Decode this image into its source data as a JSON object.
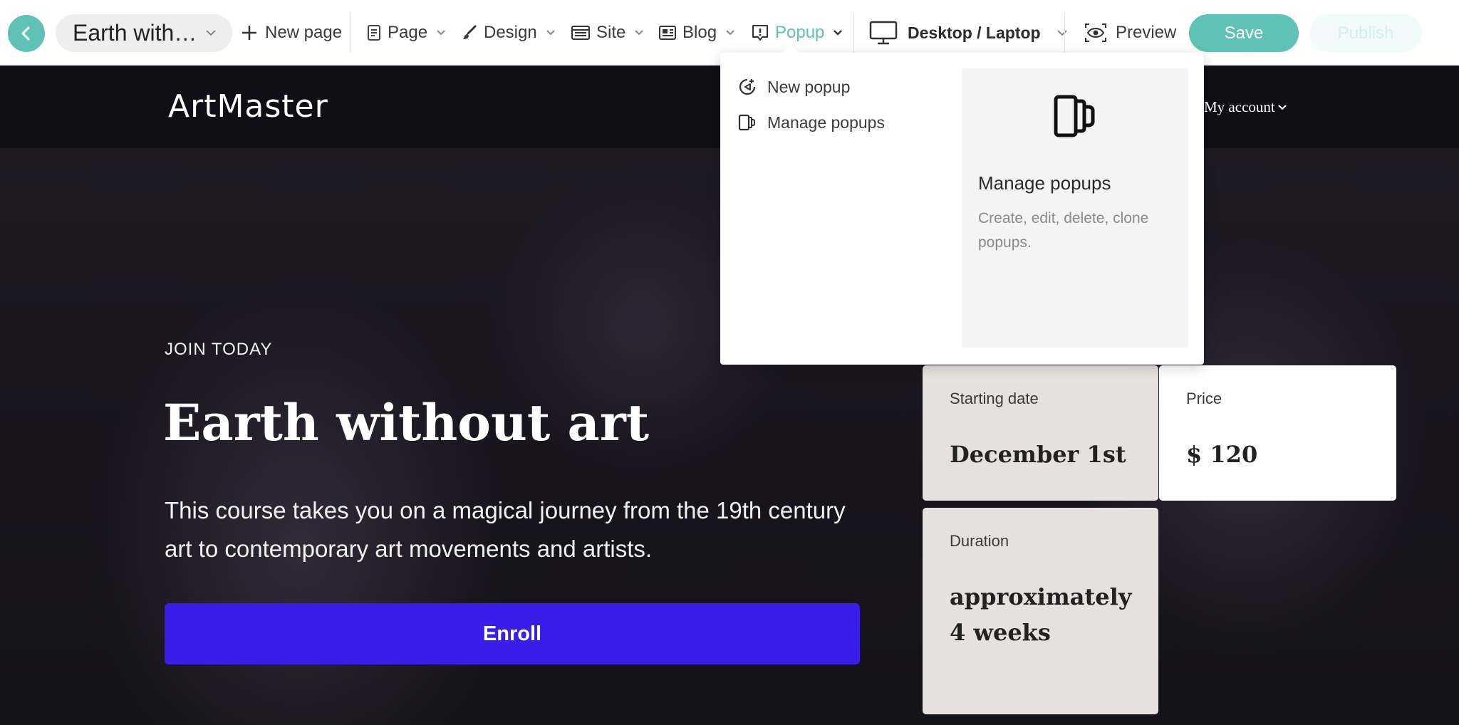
{
  "toolbar": {
    "page_title": "Earth with…",
    "new_page_label": "New page",
    "menus": [
      {
        "label": "Page"
      },
      {
        "label": "Design"
      },
      {
        "label": "Site"
      },
      {
        "label": "Blog"
      },
      {
        "label": "Popup"
      }
    ],
    "device_label": "Desktop / Laptop",
    "preview_label": "Preview",
    "save_label": "Save",
    "publish_label": "Publish",
    "accent_color": "#5fc2b5"
  },
  "popup_dropdown": {
    "items": [
      {
        "label": "New popup",
        "icon": "new-popup-icon"
      },
      {
        "label": "Manage popups",
        "icon": "manage-popups-icon"
      }
    ],
    "panel": {
      "title": "Manage popups",
      "description": "Create, edit, delete, clone popups."
    }
  },
  "site": {
    "logo": "ArtMaster",
    "account_label": "My account",
    "hero": {
      "eyebrow": "JOIN TODAY",
      "title": "Earth without art",
      "description": "This course takes you on a magical journey from the 19th century art to contemporary art movements and artists.",
      "cta_label": "Enroll",
      "cta_color": "#3a1ceb"
    },
    "cards": {
      "date": {
        "label": "Starting date",
        "value": "December 1st"
      },
      "price": {
        "label": "Price",
        "value": "$ 120"
      },
      "duration": {
        "label": "Duration",
        "value": "approximately 4 weeks"
      }
    }
  }
}
